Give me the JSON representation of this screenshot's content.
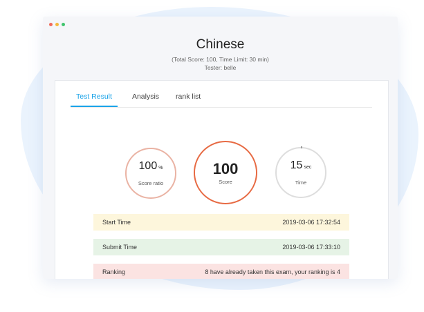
{
  "window_dots": {
    "colors": [
      "#f26a5a",
      "#f5b83b",
      "#3fc46d"
    ]
  },
  "header": {
    "title": "Chinese",
    "info": "(Total Score: 100,   Time Limit: 30 min)",
    "tester": "Tester: belle"
  },
  "tabs": [
    {
      "label": "Test Result",
      "active": true
    },
    {
      "label": "Analysis",
      "active": false
    },
    {
      "label": "rank list",
      "active": false
    }
  ],
  "stats": {
    "score_ratio": {
      "value": "100",
      "unit": "%",
      "label": "Score ratio"
    },
    "score": {
      "value": "100",
      "label": "Score"
    },
    "time": {
      "value": "15",
      "unit": "sec",
      "label": "Time"
    }
  },
  "details": [
    {
      "label": "Start Time",
      "value": "2019-03-06 17:32:54"
    },
    {
      "label": "Submit Time",
      "value": "2019-03-06 17:33:10"
    },
    {
      "label": "Ranking",
      "value": "8 have already taken this exam, your ranking is 4"
    }
  ],
  "colors": {
    "accent": "#1aa3e8",
    "score_ring": "#e76a43",
    "ratio_ring": "#eab3a4",
    "time_ring": "#dddddd",
    "row_start": "#fdf6dc",
    "row_submit": "#e6f3e6",
    "row_ranking": "#fbe3e2"
  }
}
